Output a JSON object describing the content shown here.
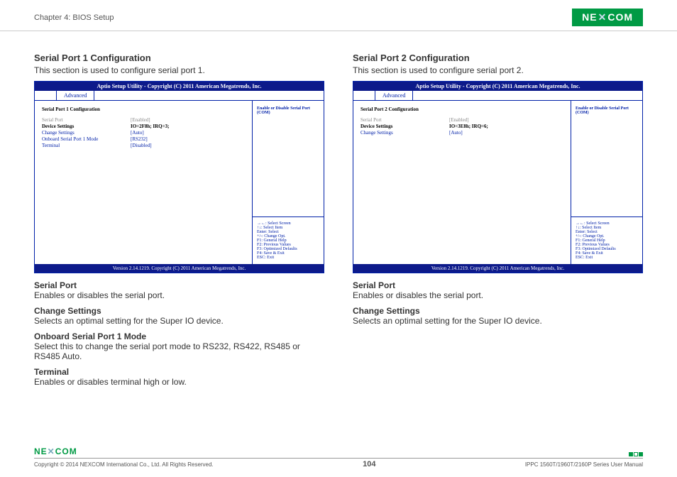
{
  "header": {
    "chapter": "Chapter 4: BIOS Setup",
    "logo": "NE✕COM"
  },
  "left": {
    "title": "Serial Port 1 Configuration",
    "desc": "This section is used to configure serial port 1.",
    "bios": {
      "topbar": "Aptio Setup Utility - Copyright (C) 2011 American Megatrends, Inc.",
      "tab": "Advanced",
      "cfg_title": "Serial Port 1 Configuration",
      "rows": [
        {
          "label": "Serial Port",
          "value": "[Enabled]",
          "lclass": "gray",
          "vclass": "gray"
        },
        {
          "label": "Device Settings",
          "value": "IO=2F8h; IRQ=3;",
          "lclass": "black",
          "vclass": "black"
        },
        {
          "label": "",
          "value": "",
          "lclass": "",
          "vclass": ""
        },
        {
          "label": "Change Settings",
          "value": "[Auto]",
          "lclass": "blue",
          "vclass": "blue"
        },
        {
          "label": "Onboard Serial Port 1 Mode",
          "value": "[RS232]",
          "lclass": "blue",
          "vclass": "blue"
        },
        {
          "label": "Terminal",
          "value": "[Disabled]",
          "lclass": "blue",
          "vclass": "blue"
        }
      ],
      "right_top": "Enable or Disable Serial Port (COM)",
      "right_bot": "→←: Select Screen\n↑↓: Select Item\nEnter: Select\n+/-: Change Opt.\nF1: General Help\nF2: Previous Values\nF3: Optimized Defaults\nF4: Save & Exit\nESC: Exit",
      "footer": "Version 2.14.1219. Copyright (C) 2011 American Megatrends, Inc."
    },
    "descs": [
      {
        "h": "Serial Port",
        "p": "Enables or disables the serial port."
      },
      {
        "h": "Change Settings",
        "p": "Selects an optimal setting for the Super IO device."
      },
      {
        "h": "Onboard Serial Port 1 Mode",
        "p": "Select this to change the serial port mode to RS232, RS422, RS485 or RS485 Auto."
      },
      {
        "h": "Terminal",
        "p": "Enables or disables terminal high or low."
      }
    ]
  },
  "right": {
    "title": "Serial Port 2 Configuration",
    "desc": "This section is used to configure serial port 2.",
    "bios": {
      "topbar": "Aptio Setup Utility - Copyright (C) 2011 American Megatrends, Inc.",
      "tab": "Advanced",
      "cfg_title": "Serial Port 2 Configuration",
      "rows": [
        {
          "label": "Serial Port",
          "value": "[Enabled]",
          "lclass": "gray",
          "vclass": "gray"
        },
        {
          "label": "Device Settings",
          "value": "IO=3E8h; IRQ=6;",
          "lclass": "black",
          "vclass": "black"
        },
        {
          "label": "",
          "value": "",
          "lclass": "",
          "vclass": ""
        },
        {
          "label": "Change Settings",
          "value": "[Auto]",
          "lclass": "blue",
          "vclass": "blue"
        }
      ],
      "right_top": "Enable or Disable Serial Port (COM)",
      "right_bot": "→←: Select Screen\n↑↓: Select Item\nEnter: Select\n+/-: Change Opt.\nF1: General Help\nF2: Previous Values\nF3: Optimized Defaults\nF4: Save & Exit\nESC: Exit",
      "footer": "Version 2.14.1219. Copyright (C) 2011 American Megatrends, Inc."
    },
    "descs": [
      {
        "h": "Serial Port",
        "p": "Enables or disables the serial port."
      },
      {
        "h": "Change Settings",
        "p": "Selects an optimal setting for the Super IO device."
      }
    ]
  },
  "footer": {
    "logo": "NE✕COM",
    "copyright": "Copyright © 2014 NEXCOM International Co., Ltd. All Rights Reserved.",
    "page": "104",
    "manual": "IPPC 1560T/1960T/2160P Series User Manual"
  }
}
